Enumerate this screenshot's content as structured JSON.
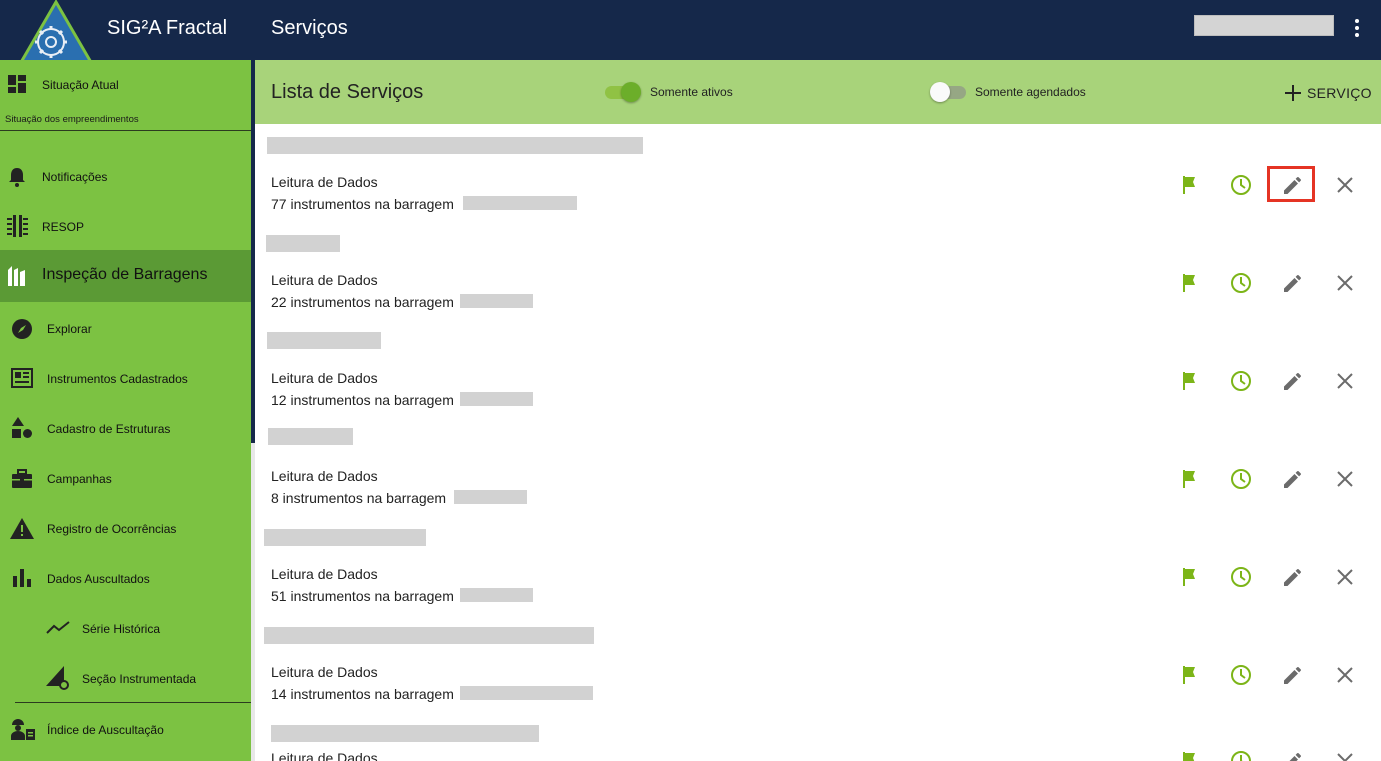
{
  "header": {
    "app_title": "SIG²A Fractal",
    "page_title": "Serviços",
    "bg_color": "#15284a"
  },
  "sidebar": {
    "bg_color": "#7cc242",
    "active_color": "#5b9a35",
    "items": [
      {
        "label": "Situação Atual",
        "icon": "dashboard-icon",
        "sub": "Situação dos empreendimentos"
      },
      {
        "label": "Notificações",
        "icon": "bell-icon"
      },
      {
        "label": "RESOP",
        "icon": "resop-icon"
      },
      {
        "label": "Inspeção de Barragens",
        "icon": "dam-icon",
        "active": true
      },
      {
        "label": "Explorar",
        "icon": "compass-icon"
      },
      {
        "label": "Instrumentos Cadastrados",
        "icon": "instruments-icon"
      },
      {
        "label": "Cadastro de Estruturas",
        "icon": "shapes-icon"
      },
      {
        "label": "Campanhas",
        "icon": "briefcase-icon"
      },
      {
        "label": "Registro de Ocorrências",
        "icon": "warning-icon"
      },
      {
        "label": "Dados Auscultados",
        "icon": "bar-chart-icon"
      },
      {
        "label": "Série Histórica",
        "icon": "trend-icon"
      },
      {
        "label": "Seção Instrumentada",
        "icon": "section-gear-icon"
      },
      {
        "label": "Índice de Auscultação",
        "icon": "engineer-icon"
      }
    ]
  },
  "content": {
    "title": "Lista de Serviços",
    "header_color": "#a8d37a",
    "toggle_active": {
      "label": "Somente ativos",
      "on": true
    },
    "toggle_scheduled": {
      "label": "Somente agendados",
      "on": false
    },
    "add_button": "SERVIÇO"
  },
  "services": [
    {
      "type": "Leitura de Dados",
      "description": "77 instrumentos na barragem"
    },
    {
      "type": "Leitura de Dados",
      "description": "22 instrumentos na barragem"
    },
    {
      "type": "Leitura de Dados",
      "description": "12 instrumentos na barragem"
    },
    {
      "type": "Leitura de Dados",
      "description": "8 instrumentos na barragem"
    },
    {
      "type": "Leitura de Dados",
      "description": "51 instrumentos na barragem"
    },
    {
      "type": "Leitura de Dados",
      "description": "14 instrumentos na barragem"
    },
    {
      "type": "Leitura de Dados",
      "description": ""
    }
  ],
  "row_actions": [
    "flag-icon",
    "clock-icon",
    "pencil-icon",
    "close-icon"
  ],
  "colors": {
    "action_green": "#7cb518",
    "action_gray": "#6b6b6b",
    "highlight_red": "#e53424"
  }
}
